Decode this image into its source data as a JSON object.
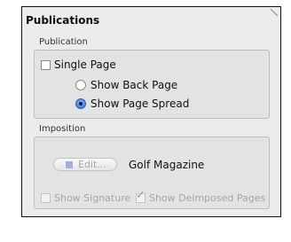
{
  "panel": {
    "title": "Publications",
    "publication_group": {
      "label": "Publication",
      "single_page_label": "Single Page",
      "single_page_checked": false,
      "show_back_page_label": "Show Back Page",
      "show_page_spread_label": "Show Page Spread",
      "selected_option": "Show Page Spread"
    },
    "imposition_group": {
      "label": "Imposition",
      "edit_button_label": "Edit...",
      "imposition_name": "Golf Magazine",
      "show_signature_label": "Show Signature",
      "show_signature_checked": false,
      "show_deimposed_label": "Show Deimposed Pages",
      "show_deimposed_checked": true
    }
  },
  "colors": {
    "panel_bg": "#ececec",
    "group_bg": "#e3e3e3",
    "radio_selected": "#2f6fd6",
    "disabled_text": "#a6a6a6"
  }
}
